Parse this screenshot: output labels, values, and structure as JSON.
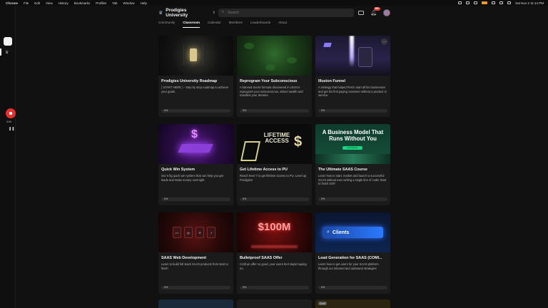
{
  "menubar": {
    "app": "Chrome",
    "items": [
      "File",
      "Edit",
      "View",
      "History",
      "Bookmarks",
      "Profiles",
      "Tab",
      "Window",
      "Help"
    ],
    "datetime": "Sat Nov 2  11:14 PM"
  },
  "rail": {
    "timer": "0:00"
  },
  "header": {
    "community_name": "Prodigies University",
    "search_placeholder": "Search",
    "notification_count": "99+"
  },
  "tabs": [
    "Community",
    "Classroom",
    "Calendar",
    "Members",
    "Leaderboards",
    "About"
  ],
  "courses": [
    {
      "title": "Prodigies University Roadmap",
      "desc": "( START HERE ) - Step by step roadmap to achieve your goals.",
      "progress": 0,
      "progress_label": "0%"
    },
    {
      "title": "Reprogram Your Subconscious",
      "desc": "A banned secret formula discovered in 1919 to reprogram your subconscious, attract wealth and manifest your dreams.",
      "progress": 0,
      "progress_label": "0%"
    },
    {
      "title": "Illusion Funnel",
      "desc": "A strategy that helped Perrin start all his businesses and get his first paying customer without a product or service.",
      "progress": 0,
      "progress_label": "0%"
    },
    {
      "title": "Quick Win System",
      "desc": "Our 6 fig quick win system that can help you get leads and make money overnight.",
      "progress": 0,
      "progress_label": "0%"
    },
    {
      "title": "Get Lifetime Access to PU",
      "desc": "Reach level 7 to get lifetime access to PU. Level up Prodigies!",
      "progress": 0,
      "progress_label": "0%"
    },
    {
      "title": "The Ultimate SAAS Course",
      "desc": "Learn how to start, market and launch a successful SAAS without ever writing a single line of code! Start to finish SOP.",
      "progress": 0,
      "progress_label": "0%"
    },
    {
      "title": "SAAS Web Development",
      "desc": "Learn to build full stack SAAS products from start to finish",
      "progress": 0,
      "progress_label": "0%"
    },
    {
      "title": "Bulletproof SAAS Offer",
      "desc": "Craft an offer so good, your users feel stupid saying no.",
      "progress": 0,
      "progress_label": "0%"
    },
    {
      "title": "Lead Generation for SAAS (COMI...",
      "desc": "Learn how to get users for your SAAS platform through our inbound and outbound strategies",
      "progress": 0,
      "progress_label": "0%"
    }
  ],
  "thumbs": {
    "lifetime_text": "LIFETIME ACCESS",
    "biz_headline": "A Business Model That Runs Without You",
    "biz_button": "Get Started",
    "hundred_m": "$100M",
    "clients": "Clients"
  },
  "peek_tag": "Draft"
}
